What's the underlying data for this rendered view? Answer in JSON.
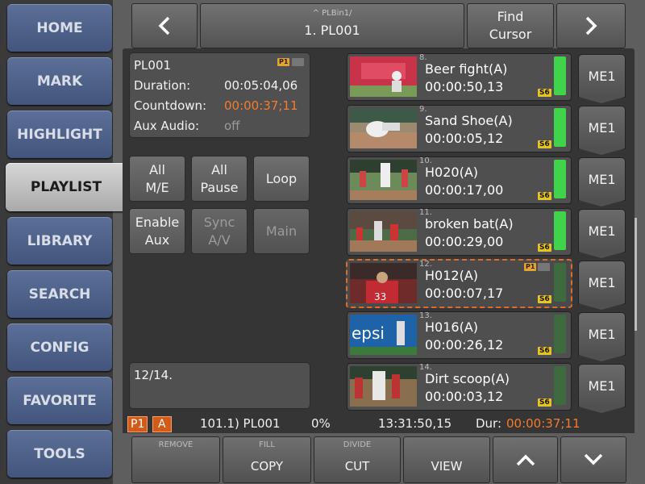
{
  "nav": {
    "home": "HOME",
    "mark": "MARK",
    "highlight": "HIGHLIGHT",
    "playlist": "PLAYLIST",
    "library": "LIBRARY",
    "search": "SEARCH",
    "config": "CONFIG",
    "favorite": "FAVORITE",
    "tools": "TOOLS",
    "active": "PLAYLIST"
  },
  "header": {
    "path": "^ PLBin1/",
    "title": "1. PL001",
    "find_cursor": "Find\nCursor",
    "prev_icon": "chevron-left-icon",
    "next_icon": "chevron-right-icon"
  },
  "info": {
    "name": "PL001",
    "badge": "P1",
    "duration_label": "Duration:",
    "duration": "00:05:04,06",
    "countdown_label": "Countdown:",
    "countdown": "00:00:37;11",
    "aux_label": "Aux Audio:",
    "aux": "off"
  },
  "actions": {
    "all_me": "All\nM/E",
    "all_pause": "All\nPause",
    "loop": "Loop",
    "enable_aux": "Enable\nAux",
    "sync_av": "Sync\nA/V",
    "main": "Main"
  },
  "position": "12/14.",
  "clips": [
    {
      "num": "8.",
      "name": "Beer fight(A)",
      "dur": "00:00:50,13",
      "tag": "S6",
      "bar": "bright",
      "me": "ME1"
    },
    {
      "num": "9.",
      "name": "Sand Shoe(A)",
      "dur": "00:00:05,12",
      "tag": "S6",
      "bar": "bright",
      "me": "ME1"
    },
    {
      "num": "10.",
      "name": "H020(A)",
      "dur": "00:00:17,00",
      "tag": "S6",
      "bar": "bright",
      "me": "ME1"
    },
    {
      "num": "11.",
      "name": "broken bat(A)",
      "dur": "00:00:29,00",
      "tag": "S6",
      "bar": "bright",
      "me": "ME1"
    },
    {
      "num": "12.",
      "name": "H012(A)",
      "dur": "00:00:07,17",
      "tag": "S6",
      "bar": "dim",
      "me": "ME1",
      "badge": "P1",
      "selected": true
    },
    {
      "num": "13.",
      "name": "H016(A)",
      "dur": "00:00:26,12",
      "tag": "S6",
      "bar": "dim",
      "me": "ME1"
    },
    {
      "num": "14.",
      "name": "Dirt scoop(A)",
      "dur": "00:00:03,12",
      "tag": "S6",
      "bar": "dim",
      "me": "ME1"
    }
  ],
  "status": {
    "p1": "P1",
    "a": "A",
    "clip": "101.1) PL001",
    "percent": "0%",
    "timecode": "13:31:50,15",
    "dur_label": "Dur:",
    "dur": "00:00:37;11"
  },
  "bottom": {
    "remove": "REMOVE",
    "fill": "FILL",
    "copy": "COPY",
    "divide": "DIVIDE",
    "cut": "CUT",
    "view": "VIEW",
    "up_icon": "chevron-up-icon",
    "down_icon": "chevron-down-icon"
  },
  "colors": {
    "accent": "#f47c2a",
    "nav_blue": "#4d6089",
    "active_nav": "#c4c4c4",
    "green_bar": "#3fd44a",
    "dim_bar": "#3f6a3f"
  }
}
